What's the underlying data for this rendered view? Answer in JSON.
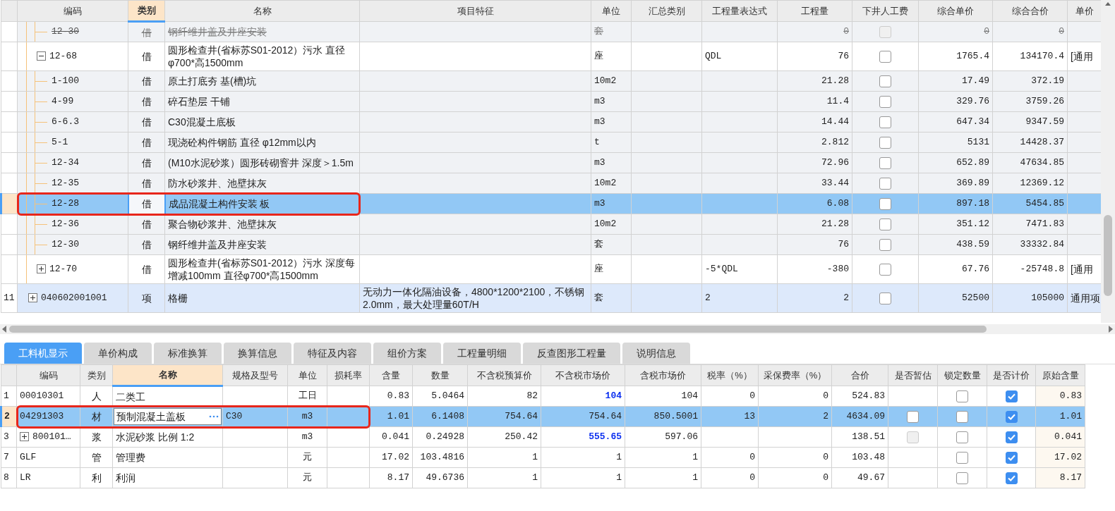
{
  "top_table": {
    "columns": [
      {
        "label": "编码",
        "selected": false
      },
      {
        "label": "类别",
        "selected": true
      },
      {
        "label": "名称",
        "selected": false
      },
      {
        "label": "项目特征",
        "selected": false
      },
      {
        "label": "单位",
        "selected": false
      },
      {
        "label": "汇总类别",
        "selected": false
      },
      {
        "label": "工程量表达式",
        "selected": false
      },
      {
        "label": "工程量",
        "selected": false
      },
      {
        "label": "下井人工费",
        "selected": false
      },
      {
        "label": "综合单价",
        "selected": false
      },
      {
        "label": "综合合价",
        "selected": false
      },
      {
        "label": "单价",
        "selected": false
      }
    ],
    "rows": [
      {
        "children": [
          {
            "children": [
              {
                "kind": "sub",
                "code": "12-30",
                "type": "借",
                "name": "钢纤维井盖及井座安装",
                "unit": "套",
                "quantity": "0",
                "fee": {
                  "checked": false,
                  "disabled": true
                },
                "unit_price": "0",
                "total": "0",
                "deleted": true,
                "selected": false
              }
            ]
          },
          {
            "kind": "quota",
            "code": "12-68",
            "expanded": true,
            "type": "借",
            "name": "圆形检查井(省标苏S01-2012）污水 直径φ700*高1500mm",
            "unit": "座",
            "expression": "QDL",
            "quantity": "76",
            "fee": {
              "checked": false,
              "disabled": false
            },
            "unit_price": "1765.4",
            "total": "134170.4",
            "column_13": "[通用",
            "deleted": false,
            "selected": false,
            "children": [
              {
                "kind": "sub",
                "code": "1-100",
                "type": "借",
                "name": "原土打底夯 基(槽)坑",
                "unit": "10m2",
                "quantity": "21.28",
                "fee": {
                  "checked": false,
                  "disabled": false
                },
                "unit_price": "17.49",
                "total": "372.19",
                "deleted": false,
                "selected": false
              },
              {
                "kind": "sub",
                "code": "4-99",
                "type": "借",
                "name": "碎石垫层 干铺",
                "unit": "m3",
                "quantity": "11.4",
                "fee": {
                  "checked": false,
                  "disabled": false
                },
                "unit_price": "329.76",
                "total": "3759.26",
                "deleted": false,
                "selected": false
              },
              {
                "kind": "sub",
                "code": "6-6.3",
                "type": "借",
                "name": "C30混凝土底板",
                "unit": "m3",
                "quantity": "14.44",
                "fee": {
                  "checked": false,
                  "disabled": false
                },
                "unit_price": "647.34",
                "total": "9347.59",
                "deleted": false,
                "selected": false
              },
              {
                "kind": "sub",
                "code": "5-1",
                "type": "借",
                "name": "现浇砼构件钢筋 直径 φ12mm以内",
                "unit": "t",
                "quantity": "2.812",
                "fee": {
                  "checked": false,
                  "disabled": false
                },
                "unit_price": "5131",
                "total": "14428.37",
                "deleted": false,
                "selected": false
              },
              {
                "kind": "sub",
                "code": "12-34",
                "type": "借",
                "name": "(M10水泥砂浆）圆形砖砌窨井 深度＞1.5m",
                "unit": "m3",
                "quantity": "72.96",
                "fee": {
                  "checked": false,
                  "disabled": false
                },
                "unit_price": "652.89",
                "total": "47634.85",
                "deleted": false,
                "selected": false
              },
              {
                "kind": "sub",
                "code": "12-35",
                "type": "借",
                "name": "防水砂浆井、池壁抹灰",
                "unit": "10m2",
                "quantity": "33.44",
                "fee": {
                  "checked": false,
                  "disabled": false
                },
                "unit_price": "369.89",
                "total": "12369.12",
                "deleted": false,
                "selected": false
              },
              {
                "kind": "sub",
                "code": "12-28",
                "type": "借",
                "name": "成品混凝土构件安装 板",
                "unit": "m3",
                "quantity": "6.08",
                "fee": {
                  "checked": false,
                  "disabled": false
                },
                "unit_price": "897.18",
                "total": "5454.85",
                "deleted": false,
                "selected": true,
                "annotated": true
              },
              {
                "kind": "sub",
                "code": "12-36",
                "type": "借",
                "name": "聚合物砂浆井、池壁抹灰",
                "unit": "10m2",
                "quantity": "21.28",
                "fee": {
                  "checked": false,
                  "disabled": false
                },
                "unit_price": "351.12",
                "total": "7471.83",
                "deleted": false,
                "selected": false
              },
              {
                "kind": "sub",
                "code": "12-30",
                "type": "借",
                "name": "钢纤维井盖及井座安装",
                "unit": "套",
                "quantity": "76",
                "fee": {
                  "checked": false,
                  "disabled": false
                },
                "unit_price": "438.59",
                "total": "33332.84",
                "deleted": false,
                "selected": false
              }
            ]
          },
          {
            "kind": "quota",
            "code": "12-70",
            "expanded": false,
            "type": "借",
            "name": "圆形检查井(省标苏S01-2012）污水 深度每增减100mm 直径φ700*高1500mm",
            "unit": "座",
            "expression": "-5*QDL",
            "quantity": "-380",
            "fee": {
              "checked": false,
              "disabled": false
            },
            "unit_price": "67.76",
            "total": "-25748.8",
            "column_13": "[通用",
            "deleted": false,
            "selected": false
          }
        ]
      },
      {
        "kind": "item",
        "number": "11",
        "code": "040602001001",
        "expanded": false,
        "type": "项",
        "name": "格栅",
        "features": "无动力一体化隔油设备，4800*1200*2100，不锈钢2.0mm，最大处理量60T/H",
        "unit": "套",
        "expression": "2",
        "quantity": "2",
        "fee": {
          "checked": false,
          "disabled": false
        },
        "unit_price": "52500",
        "total": "105000",
        "column_13": "通用项",
        "deleted": false,
        "selected": false
      }
    ]
  },
  "tabs": [
    {
      "label": "工料机显示",
      "selected": true
    },
    {
      "label": "单价构成",
      "selected": false
    },
    {
      "label": "标准换算",
      "selected": false
    },
    {
      "label": "换算信息",
      "selected": false
    },
    {
      "label": "特征及内容",
      "selected": false
    },
    {
      "label": "组价方案",
      "selected": false
    },
    {
      "label": "工程量明细",
      "selected": false
    },
    {
      "label": "反查图形工程量",
      "selected": false
    },
    {
      "label": "说明信息",
      "selected": false
    }
  ],
  "bottom_table": {
    "columns": [
      {
        "label": "编码",
        "selected": false
      },
      {
        "label": "类别",
        "selected": false
      },
      {
        "label": "名称",
        "selected": true
      },
      {
        "label": "规格及型号",
        "selected": false
      },
      {
        "label": "单位",
        "selected": false
      },
      {
        "label": "损耗率",
        "selected": false
      },
      {
        "label": "含量",
        "selected": false
      },
      {
        "label": "数量",
        "selected": false
      },
      {
        "label": "不含税预算价",
        "selected": false
      },
      {
        "label": "不含税市场价",
        "selected": false
      },
      {
        "label": "含税市场价",
        "selected": false
      },
      {
        "label": "税率（%）",
        "selected": false
      },
      {
        "label": "采保费率（%）",
        "selected": false
      },
      {
        "label": "合价",
        "selected": false
      },
      {
        "label": "是否暂估",
        "selected": false
      },
      {
        "label": "锁定数量",
        "selected": false
      },
      {
        "label": "是否计价",
        "selected": false
      },
      {
        "label": "原始含量",
        "selected": false
      }
    ],
    "rows": [
      {
        "number": "1",
        "code": "00010301",
        "type": "人",
        "name": "二类工",
        "unit": "工日",
        "content": "0.83",
        "quantity": "5.0464",
        "budget_price": "82",
        "market_price": "104",
        "price_changed": true,
        "tax_price": "104",
        "tax_rate": "0",
        "fee_rate": "0",
        "total": "524.83",
        "lock": {
          "checked": false
        },
        "priced": {
          "checked": true
        },
        "original": "0.83",
        "selected": false
      },
      {
        "number": "2",
        "code": "04291303",
        "type": "材",
        "name": "预制混凝土盖板",
        "spec": "C30",
        "unit": "m3",
        "content": "1.01",
        "quantity": "6.1408",
        "budget_price": "754.64",
        "market_price": "754.64",
        "price_changed": false,
        "tax_price": "850.5001",
        "tax_rate": "13",
        "fee_rate": "2",
        "total": "4634.09",
        "provisional": {
          "checked": false,
          "disabled": false
        },
        "lock": {
          "checked": false
        },
        "priced": {
          "checked": true
        },
        "original": "1.01",
        "selected": true,
        "annotated": true
      },
      {
        "number": "3",
        "code": "800101…",
        "expanded": false,
        "type": "浆",
        "name": "水泥砂浆 比例 1:2",
        "unit": "m3",
        "content": "0.041",
        "quantity": "0.24928",
        "budget_price": "250.42",
        "market_price": "555.65",
        "price_changed": true,
        "tax_price": "597.06",
        "total": "138.51",
        "provisional": {
          "checked": false,
          "disabled": true
        },
        "lock": {
          "checked": false
        },
        "priced": {
          "checked": true
        },
        "original": "0.041",
        "selected": false
      },
      {
        "number": "7",
        "code": "GLF",
        "type": "管",
        "name": "管理费",
        "unit": "元",
        "content": "17.02",
        "quantity": "103.4816",
        "budget_price": "1",
        "market_price": "1",
        "price_changed": false,
        "tax_price": "1",
        "tax_rate": "0",
        "fee_rate": "0",
        "total": "103.48",
        "lock": {
          "checked": false
        },
        "priced": {
          "checked": true
        },
        "original": "17.02",
        "selected": false
      },
      {
        "number": "8",
        "code": "LR",
        "type": "利",
        "name": "利润",
        "unit": "元",
        "content": "8.17",
        "quantity": "49.6736",
        "budget_price": "1",
        "market_price": "1",
        "price_changed": false,
        "tax_price": "1",
        "tax_rate": "0",
        "fee_rate": "0",
        "total": "49.67",
        "lock": {
          "checked": false
        },
        "priced": {
          "checked": true
        },
        "original": "8.17",
        "selected": false
      }
    ]
  }
}
